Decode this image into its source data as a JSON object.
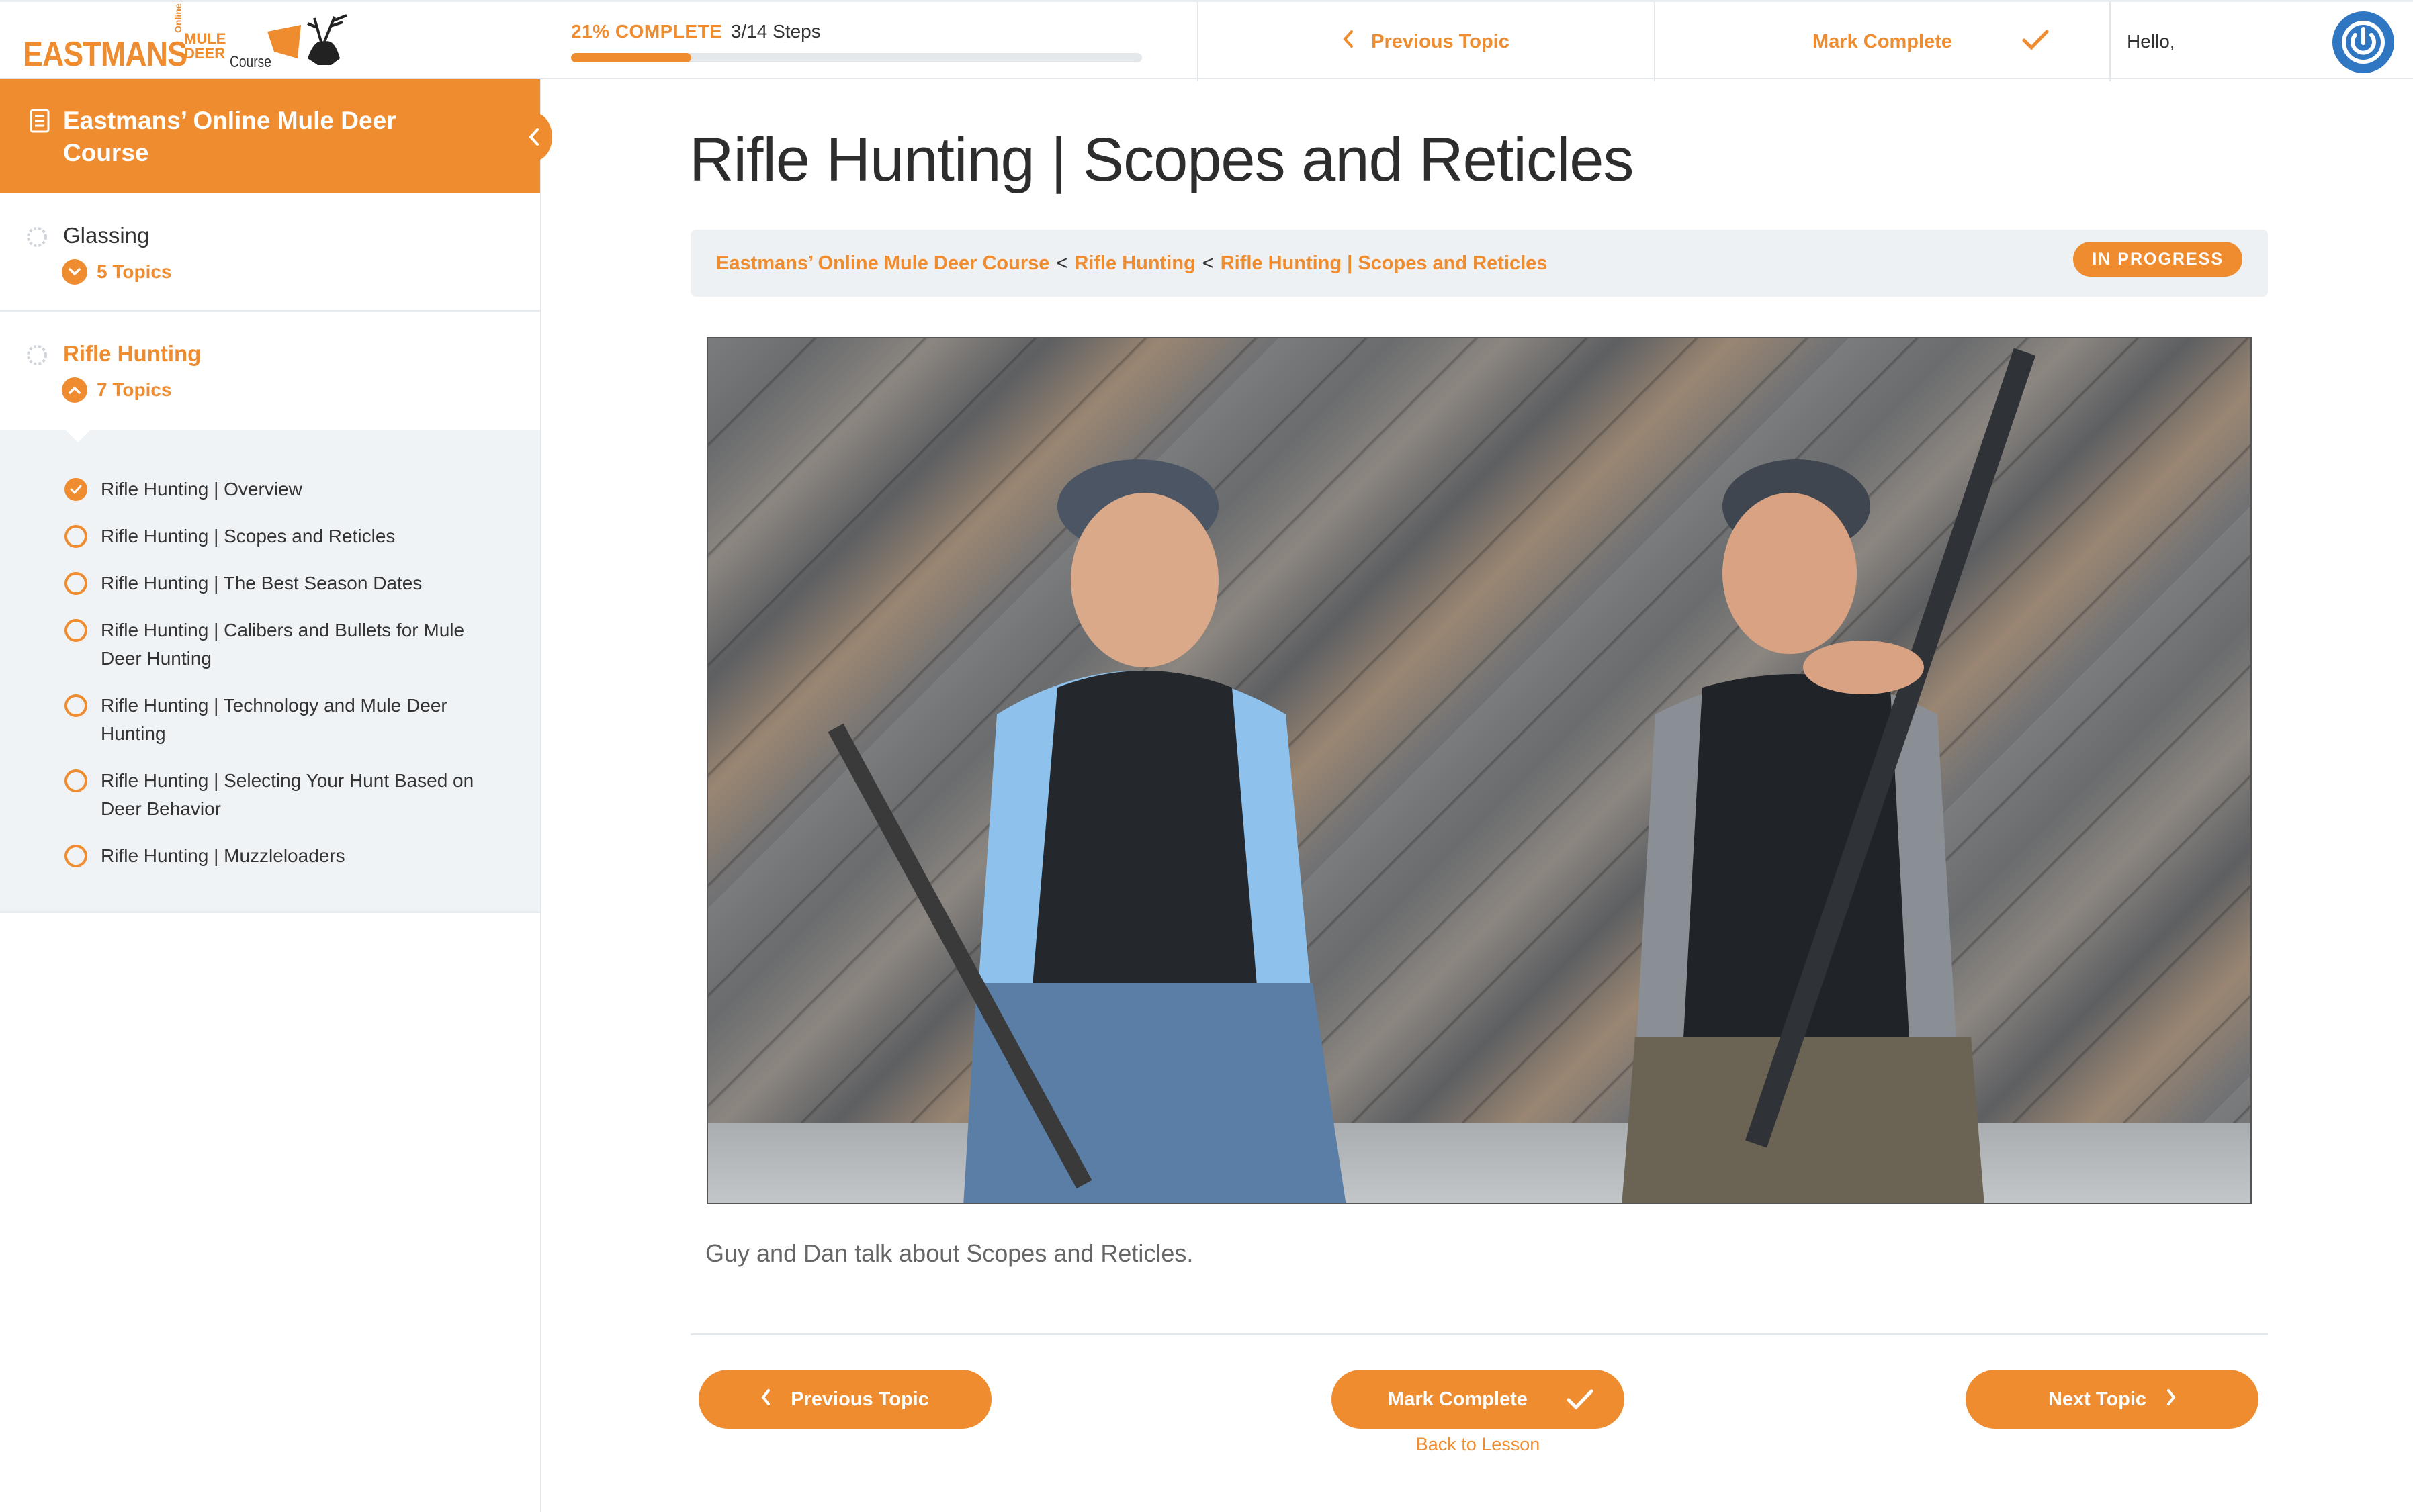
{
  "colors": {
    "accent": "#ee8c2f",
    "avatar": "#2f76c3",
    "text": "#333333",
    "panel": "#f0f3f6"
  },
  "logo": {
    "word": "EASTMANS",
    "online": "Online",
    "line1": "MULE",
    "line2": "DEER",
    "line3": "Course"
  },
  "header": {
    "progress_percent_label": "21% COMPLETE",
    "progress_fraction": 0.21,
    "steps_label": "3/14 Steps",
    "prev_topic": "Previous Topic",
    "mark_complete": "Mark Complete",
    "greeting": "Hello,"
  },
  "sidebar": {
    "course_title": "Eastmans’ Online Mule Deer Course",
    "lessons": [
      {
        "title": "Glassing",
        "topics_label": "5 Topics",
        "expanded": false
      },
      {
        "title": "Rifle Hunting",
        "topics_label": "7 Topics",
        "expanded": true
      }
    ],
    "topics": [
      {
        "label": "Rifle Hunting | Overview",
        "done": true
      },
      {
        "label": "Rifle Hunting | Scopes and Reticles",
        "done": false
      },
      {
        "label": "Rifle Hunting | The Best Season Dates",
        "done": false
      },
      {
        "label": "Rifle Hunting | Calibers and Bullets for Mule Deer Hunting",
        "done": false
      },
      {
        "label": "Rifle Hunting | Technology and Mule Deer Hunting",
        "done": false
      },
      {
        "label": "Rifle Hunting | Selecting Your Hunt Based on Deer Behavior",
        "done": false
      },
      {
        "label": "Rifle Hunting | Muzzleloaders",
        "done": false
      }
    ]
  },
  "main": {
    "title": "Rifle Hunting | Scopes and Reticles",
    "breadcrumb": [
      "Eastmans’ Online Mule Deer Course",
      "Rifle Hunting",
      "Rifle Hunting | Scopes and Reticles"
    ],
    "breadcrumb_sep": "<",
    "status": "IN PROGRESS",
    "caption": "Guy and Dan talk about Scopes and Reticles.",
    "buttons": {
      "prev": "Previous Topic",
      "mark": "Mark Complete",
      "next": "Next Topic"
    },
    "back_link": "Back to Lesson"
  }
}
